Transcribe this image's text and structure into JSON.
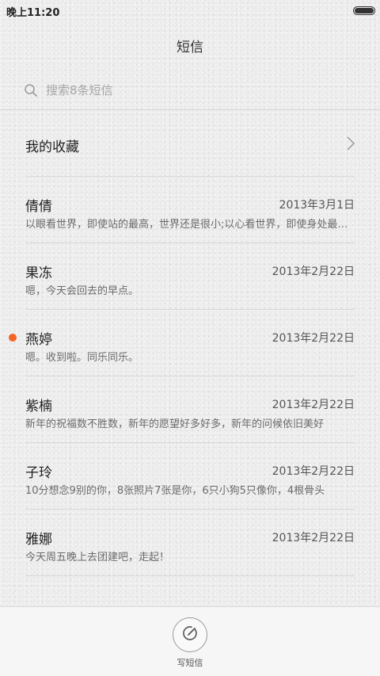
{
  "status_bar": {
    "time": "晚上11:20"
  },
  "header": {
    "title": "短信"
  },
  "search": {
    "placeholder": "搜索8条短信"
  },
  "favorites": {
    "label": "我的收藏"
  },
  "messages": [
    {
      "name": "倩倩",
      "date": "2013年3月1日",
      "preview": "以眼看世界，即使站的最高，世界还是很小;以心看世界，即使身处最低，世界也是广阔的",
      "unread": false
    },
    {
      "name": "果冻",
      "date": "2013年2月22日",
      "preview": "嗯，今天会回去的早点。",
      "unread": false
    },
    {
      "name": "燕婷",
      "date": "2013年2月22日",
      "preview": "嗯。收到啦。同乐同乐。",
      "unread": true
    },
    {
      "name": "紫楠",
      "date": "2013年2月22日",
      "preview": "新年的祝福数不胜数，新年的愿望好多好多，新年的问候依旧美好",
      "unread": false
    },
    {
      "name": "子玲",
      "date": "2013年2月22日",
      "preview": "10分想念9别的你，8张照片7张是你，6只小狗5只像你，4根骨头",
      "unread": false
    },
    {
      "name": "雅娜",
      "date": "2013年2月22日",
      "preview": "今天周五晚上去团建吧，走起！",
      "unread": false
    }
  ],
  "bottom_bar": {
    "compose_label": "写短信"
  },
  "colors": {
    "unread_dot": "#f26522"
  },
  "icons": {
    "search": "search-icon",
    "chevron": "chevron-right-icon",
    "compose": "compose-icon",
    "battery": "battery-icon"
  }
}
